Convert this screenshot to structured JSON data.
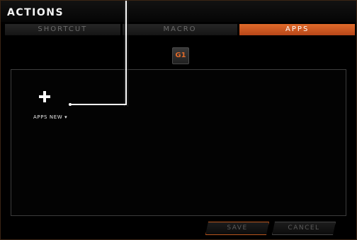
{
  "window": {
    "title": "ACTIONS"
  },
  "tabs": [
    {
      "label": "SHORTCUT",
      "active": false
    },
    {
      "label": "MACRO",
      "active": false
    },
    {
      "label": "APPS",
      "active": true
    }
  ],
  "gkey": {
    "label": "G1"
  },
  "apps": {
    "add_icon": "plus-icon",
    "new_label": "APPS NEW ▾"
  },
  "buttons": {
    "save": "SAVE",
    "cancel": "CANCEL"
  },
  "colors": {
    "accent": "#e06a2a",
    "background": "#000000",
    "inactive_text": "#6b6b6b"
  }
}
